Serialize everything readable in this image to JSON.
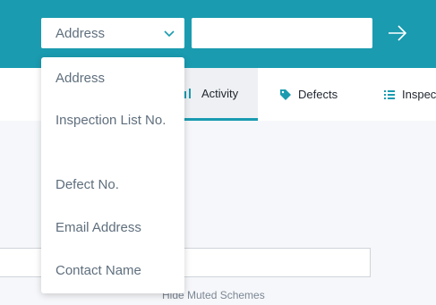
{
  "header": {
    "search_type_selected": "Address",
    "search_placeholder": "",
    "go_icon": "arrow-right-icon"
  },
  "tabs": [
    {
      "label": "Activity",
      "icon": "bar-chart-icon",
      "active": true
    },
    {
      "label": "Defects",
      "icon": "tag-icon",
      "active": false
    },
    {
      "label": "Inspec",
      "icon": "list-icon",
      "active": false
    }
  ],
  "search_type_options": [
    "Address",
    "Inspection List No.",
    "Defect No.",
    "Email Address",
    "Contact Name"
  ],
  "footer": {
    "hide_muted_label": "Hide Muted Schemes"
  },
  "colors": {
    "accent": "#1a9bb0",
    "text_muted": "#5f6f7d"
  }
}
